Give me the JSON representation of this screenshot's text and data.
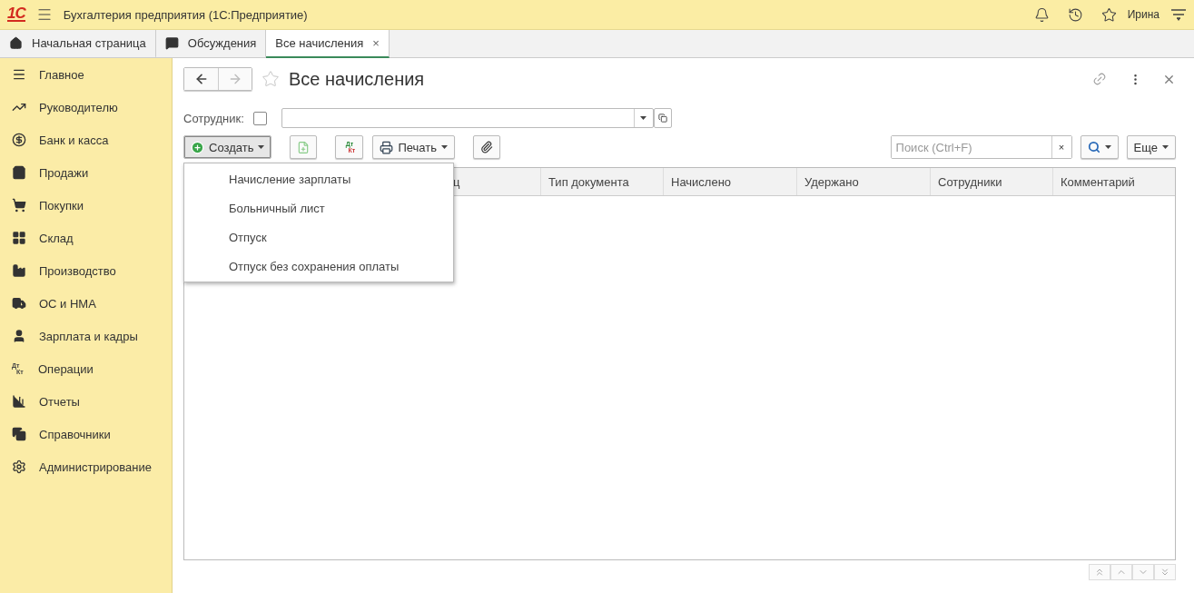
{
  "app_bar": {
    "logo": "1С",
    "title": "Бухгалтерия предприятия  (1С:Предприятие)",
    "user": "Ирина"
  },
  "tabs": [
    {
      "label": "Начальная страница",
      "selected": false
    },
    {
      "label": "Обсуждения",
      "selected": false
    },
    {
      "label": "Все начисления",
      "selected": true,
      "close": "×"
    }
  ],
  "sidebar": {
    "items": [
      {
        "label": "Главное"
      },
      {
        "label": "Руководителю"
      },
      {
        "label": "Банк и касса"
      },
      {
        "label": "Продажи"
      },
      {
        "label": "Покупки"
      },
      {
        "label": "Склад"
      },
      {
        "label": "Производство"
      },
      {
        "label": "ОС и НМА"
      },
      {
        "label": "Зарплата и кадры"
      },
      {
        "label": "Операции",
        "icon_lines": [
          "Дт",
          "Кт"
        ]
      },
      {
        "label": "Отчеты"
      },
      {
        "label": "Справочники"
      },
      {
        "label": "Администрирование"
      }
    ]
  },
  "form": {
    "title": "Все начисления",
    "favorite": false,
    "filter": {
      "label": "Сотрудник:",
      "checked": false
    },
    "toolbar": {
      "create": {
        "label": "Создать",
        "expanded": true
      },
      "dtkt": [
        "Дт",
        "Кт"
      ],
      "print": "Печать",
      "search": {
        "placeholder": "Поиск (Ctrl+F)",
        "clear": "×"
      },
      "more": "Еще"
    },
    "create_menu": [
      "Начисление зарплаты",
      "Больничный лист",
      "Отпуск",
      "Отпуск без сохранения оплаты"
    ],
    "table": {
      "columns": [
        "ц",
        "Тип документа",
        "Начислено",
        "Удержано",
        "Сотрудники",
        "Комментарий"
      ]
    }
  }
}
